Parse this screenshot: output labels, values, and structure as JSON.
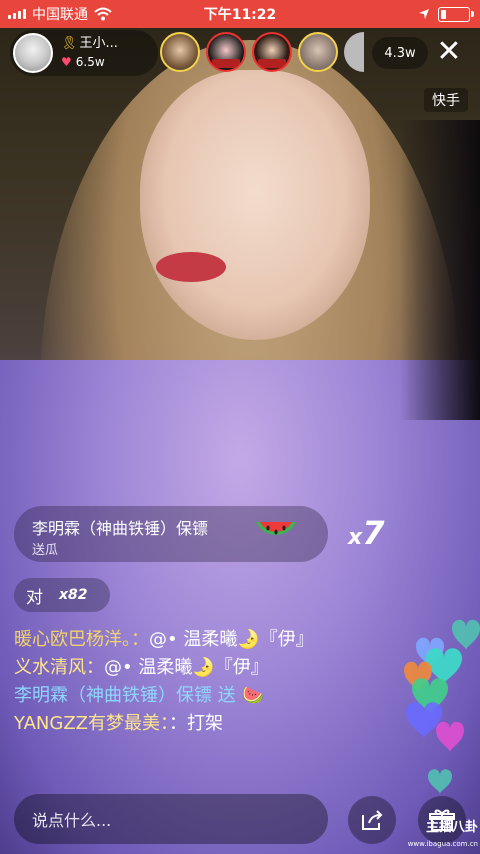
{
  "status_bar": {
    "carrier": "中国联通",
    "time": "下午11:22"
  },
  "host": {
    "name": "王小...",
    "likes": "6.5w"
  },
  "viewer_count": "4.3w",
  "brand_badge": "快手",
  "gift_banner": {
    "sender": "李明霖（神曲铁锤）保镖",
    "action": "送瓜",
    "multiplier": "7",
    "multiplier_prefix": "x"
  },
  "combo": {
    "text": "对",
    "count": "x82"
  },
  "chat": [
    {
      "user": "暖心欧巴杨洋。：",
      "message": "@• 温柔曦🌛『伊』"
    },
    {
      "user": "义水清风：",
      "message": "@• 温柔曦🌛『伊』"
    },
    {
      "user": "李明霖（神曲铁锤）保镖 送 🍉",
      "message": ""
    },
    {
      "user": "YANGZZ有梦最美：",
      "message": "：打架"
    }
  ],
  "input": {
    "placeholder": "说点什么..."
  },
  "watermark": {
    "text": "主播八卦",
    "url": "www.ibagua.com.cn"
  },
  "colors": {
    "status_bar": "#e8453c",
    "chat_user_gold": "#f2d46a",
    "chat_user_blue": "#8fd6ff"
  }
}
